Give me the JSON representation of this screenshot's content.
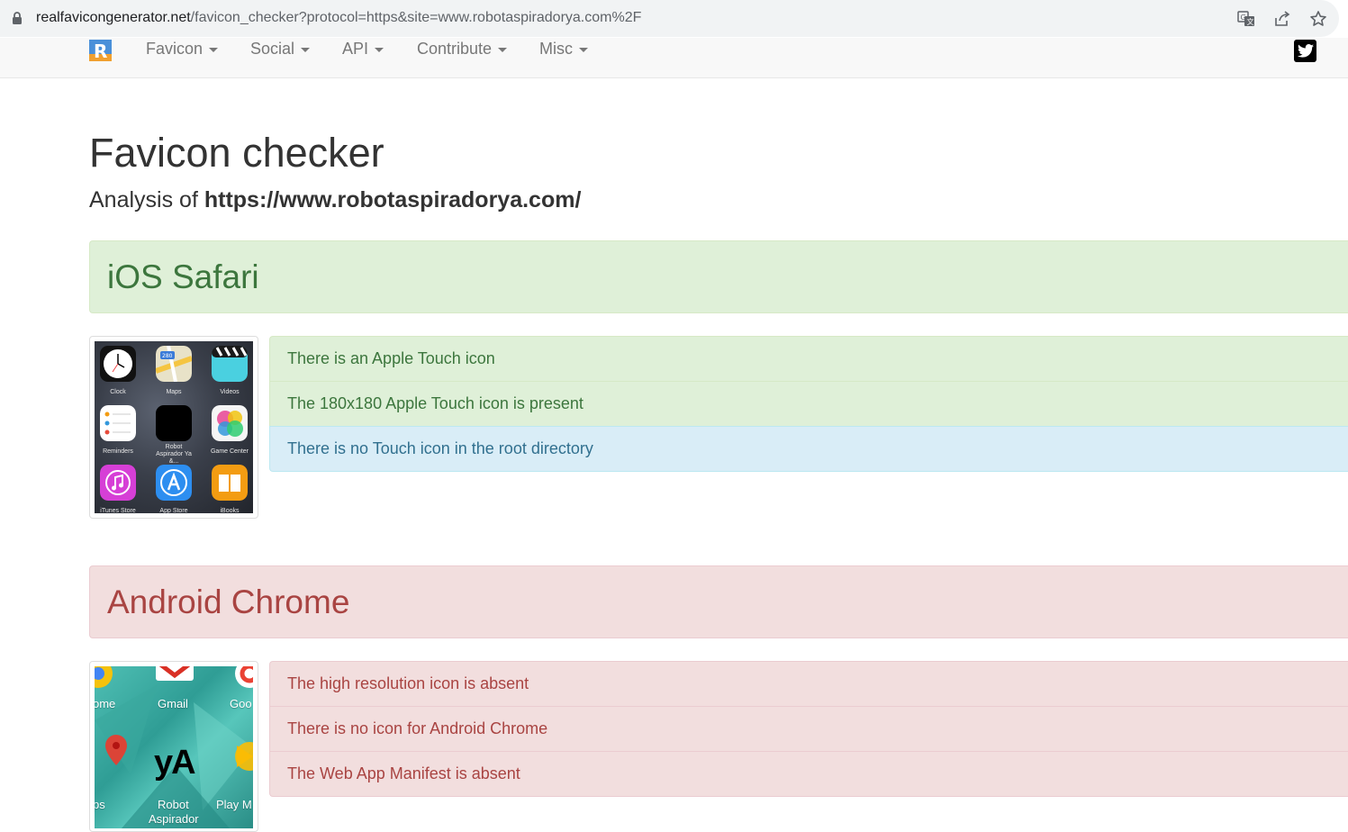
{
  "browser": {
    "url_host": "realfavicongenerator.net",
    "url_path": "/favicon_checker?protocol=https&site=www.robotaspiradorya.com%2F"
  },
  "navbar": {
    "brand_letter": "R",
    "items": [
      {
        "label": "Favicon"
      },
      {
        "label": "Social"
      },
      {
        "label": "API"
      },
      {
        "label": "Contribute"
      },
      {
        "label": "Misc"
      }
    ]
  },
  "main": {
    "title": "Favicon checker",
    "analysis_prefix": "Analysis of",
    "analysis_site": "https://www.robotaspiradorya.com/"
  },
  "ios": {
    "heading": "iOS Safari",
    "checks": [
      {
        "text": "There is an Apple Touch icon",
        "status": "success"
      },
      {
        "text": "The 180x180 Apple Touch icon is present",
        "status": "success"
      },
      {
        "text": "There is no Touch icon in the root directory",
        "status": "info"
      }
    ],
    "apps": [
      {
        "label": "Clock"
      },
      {
        "label": "Maps"
      },
      {
        "label": "Videos"
      },
      {
        "label": "Reminders"
      },
      {
        "label": "Robot Aspirador Ya &..."
      },
      {
        "label": "Game Center"
      },
      {
        "label": "iTunes Store"
      },
      {
        "label": "App Store"
      },
      {
        "label": "iBooks"
      }
    ],
    "maps_badge": "280"
  },
  "android": {
    "heading": "Android Chrome",
    "checks": [
      {
        "text": "The high resolution icon is absent",
        "status": "danger"
      },
      {
        "text": "There is no icon for Android Chrome",
        "status": "danger"
      },
      {
        "text": "The Web App Manifest is absent",
        "status": "danger"
      }
    ],
    "labels": {
      "chrome": "ome",
      "gmail": "Gmail",
      "google": "Goo",
      "maps": "ps",
      "robot_icon_text": "yA",
      "robot_line1": "Robot",
      "robot_line2": "Aspirador",
      "play": "Play M"
    }
  },
  "colors": {
    "success_bg": "#dff0d8",
    "success_text": "#3c763d",
    "info_bg": "#d9edf7",
    "info_text": "#31708f",
    "danger_bg": "#f2dede",
    "danger_text": "#a94442"
  }
}
